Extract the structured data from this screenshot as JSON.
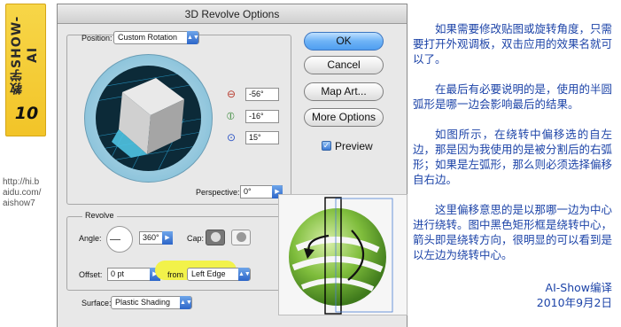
{
  "side": {
    "badge_title": "教学SHOW-AI",
    "badge_number": "10",
    "url_lines": [
      "http://hi.b",
      "aidu.com/",
      "aishow7"
    ]
  },
  "dialog": {
    "title": "3D Revolve Options",
    "position_label": "Position:",
    "position_value": "Custom Rotation",
    "rotation": {
      "x": "-56°",
      "y": "-16°",
      "z": "15°"
    },
    "perspective_label": "Perspective:",
    "perspective_value": "0°",
    "buttons": {
      "ok": "OK",
      "cancel": "Cancel",
      "map_art": "Map Art...",
      "more_options": "More Options"
    },
    "preview_label": "Preview",
    "preview_checked": true,
    "revolve": {
      "section_label": "Revolve",
      "angle_label": "Angle:",
      "angle_value": "360°",
      "cap_label": "Cap:",
      "offset_label": "Offset:",
      "offset_value": "0 pt",
      "from_label": "from",
      "from_value": "Left Edge"
    },
    "surface_label": "Surface:",
    "surface_value": "Plastic Shading"
  },
  "colors": {
    "text": "#1d44a8",
    "highlight": "#f2f24a",
    "ok_button": "#5da7f2"
  },
  "notes": {
    "paragraphs": [
      "如果需要修改贴图或旋转角度，只需要打开外观调板，双击应用的效果名就可以了。",
      "在最后有必要说明的是，使用的半圆弧形是哪一边会影响最后的结果。",
      "如图所示，在绕转中偏移选的自左边，那是因为我使用的是被分割后的右弧形；如果是左弧形，那么则必须选择偏移自右边。",
      "这里偏移意思的是以那哪一边为中心进行绕转。图中黑色矩形框是绕转中心，箭头即是绕转方向，很明显的可以看到是以左边为绕转中心。"
    ],
    "signature": "AI-Show编译",
    "date": "2010年9月2日"
  }
}
